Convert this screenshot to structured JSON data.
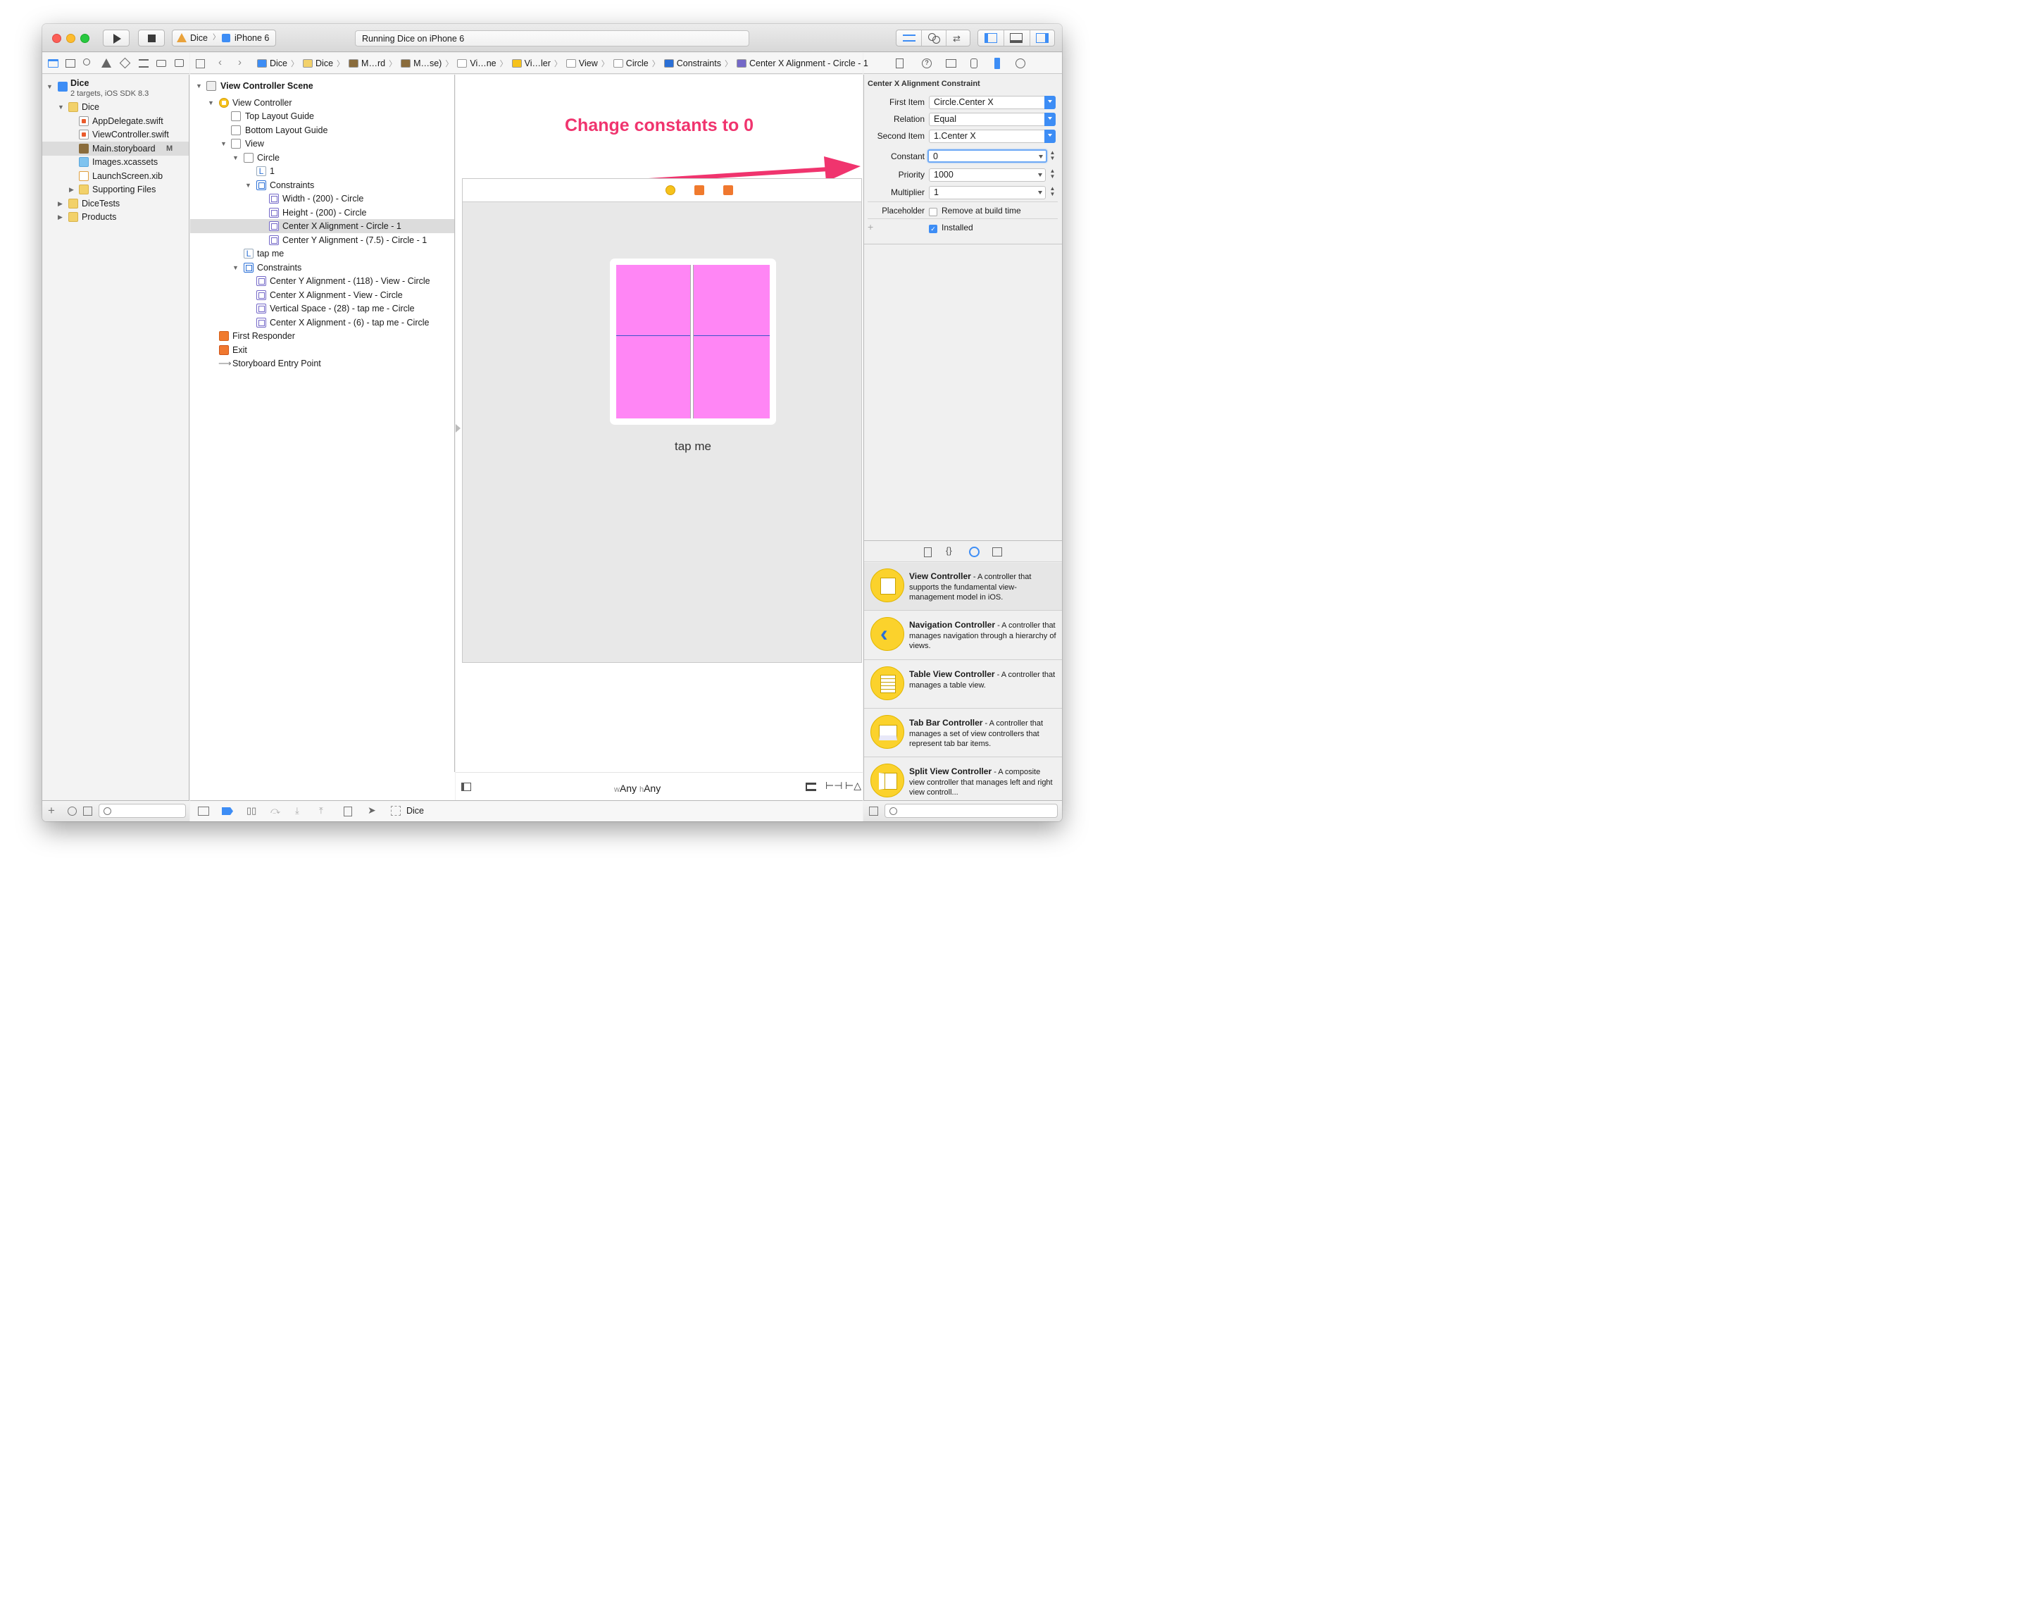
{
  "toolbar": {
    "scheme": "Dice",
    "device": "iPhone 6",
    "status": "Running Dice on iPhone 6"
  },
  "breadcrumbs": [
    "Dice",
    "Dice",
    "M…rd",
    "M…se)",
    "Vi…ne",
    "Vi…ler",
    "View",
    "Circle",
    "Constraints",
    "Center X Alignment - Circle - 1"
  ],
  "navigator": {
    "project_name": "Dice",
    "project_sub": "2 targets, iOS SDK 8.3",
    "items": [
      {
        "label": "Dice"
      },
      {
        "label": "AppDelegate.swift"
      },
      {
        "label": "ViewController.swift"
      },
      {
        "label": "Main.storyboard",
        "badge": "M"
      },
      {
        "label": "Images.xcassets"
      },
      {
        "label": "LaunchScreen.xib"
      },
      {
        "label": "Supporting Files"
      },
      {
        "label": "DiceTests"
      },
      {
        "label": "Products"
      }
    ]
  },
  "outline": {
    "scene": "View Controller Scene",
    "rows": [
      "View Controller",
      "Top Layout Guide",
      "Bottom Layout Guide",
      "View",
      "Circle",
      "1",
      "Constraints",
      "Width - (200) - Circle",
      "Height - (200) - Circle",
      "Center X Alignment - Circle - 1",
      "Center Y Alignment - (7.5) - Circle - 1",
      "tap me",
      "Constraints",
      "Center Y Alignment - (118) - View - Circle",
      "Center X Alignment - View - Circle",
      "Vertical Space - (28) - tap me - Circle",
      "Center X Alignment - (6) - tap me - Circle",
      "First Responder",
      "Exit",
      "Storyboard Entry Point"
    ]
  },
  "canvas": {
    "annotation": "Change constants to 0",
    "button_label": "tap me",
    "size_class_w": "Any",
    "size_class_h": "Any",
    "w_prefix": "w",
    "h_prefix": "h",
    "annotation_color": "#f0346e",
    "circle_color": "#ff86f5"
  },
  "inspector": {
    "title": "Center X Alignment Constraint",
    "first_item_label": "First Item",
    "first_item": "Circle.Center X",
    "relation_label": "Relation",
    "relation": "Equal",
    "second_item_label": "Second Item",
    "second_item": "1.Center X",
    "constant_label": "Constant",
    "constant": "0",
    "priority_label": "Priority",
    "priority": "1000",
    "multiplier_label": "Multiplier",
    "multiplier": "1",
    "placeholder_label": "Placeholder",
    "placeholder_option": "Remove at build time",
    "installed_label": "Installed"
  },
  "library": [
    {
      "name": "View Controller",
      "desc": " - A controller that supports the fundamental view-management model in iOS."
    },
    {
      "name": "Navigation Controller",
      "desc": " - A controller that manages navigation through a hierarchy of views."
    },
    {
      "name": "Table View Controller",
      "desc": " - A controller that manages a table view."
    },
    {
      "name": "Tab Bar Controller",
      "desc": " - A controller that manages a set of view controllers that represent tab bar items."
    },
    {
      "name": "Split View Controller",
      "desc": " - A composite view controller that manages left and right view controll..."
    }
  ],
  "debugbar": {
    "target": "Dice"
  },
  "colors": {
    "accent": "#3d8df5",
    "selection": "#dcdcdc"
  }
}
